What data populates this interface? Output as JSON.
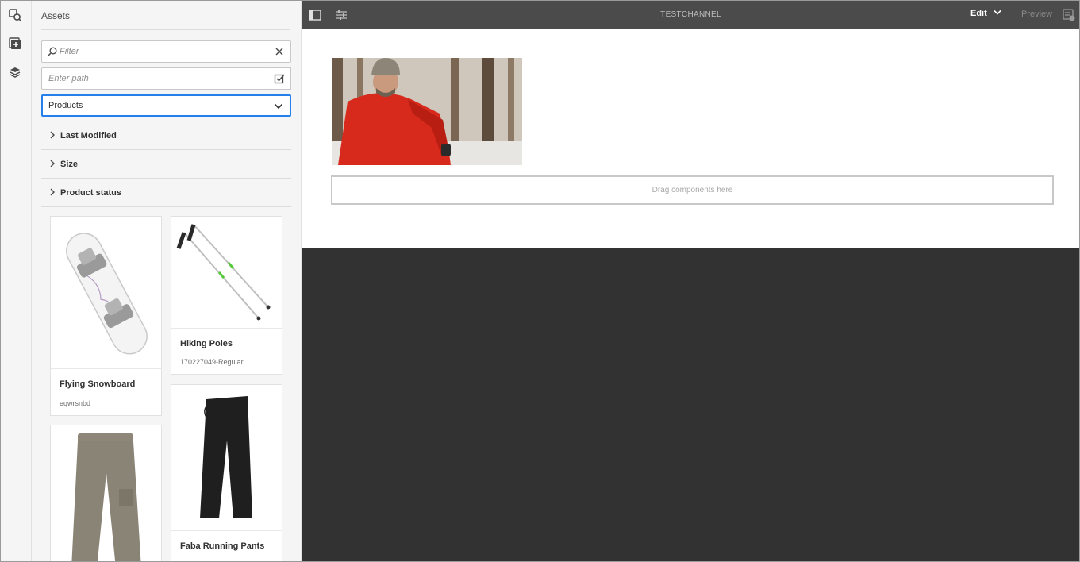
{
  "rail": {
    "items": [
      {
        "icon": "assets-icon"
      },
      {
        "icon": "components-icon"
      },
      {
        "icon": "content-tree-icon"
      }
    ]
  },
  "panel": {
    "title": "Assets",
    "filter_placeholder": "Filter",
    "path_placeholder": "Enter path",
    "asset_type": "Products",
    "facets": [
      "Last Modified",
      "Size",
      "Product status"
    ],
    "cards": [
      {
        "title": "Flying Snowboard",
        "subtitle": "eqwrsnbd"
      },
      {
        "title": "Hiking Poles",
        "subtitle": "170227049-Regular"
      },
      {
        "title": "",
        "subtitle": ""
      },
      {
        "title": "Faba Running Pants",
        "subtitle": ""
      }
    ]
  },
  "topbar": {
    "title": "TESTCHANNEL",
    "mode": "Edit",
    "preview": "Preview"
  },
  "canvas": {
    "dropzone_text": "Drag components here"
  },
  "colors": {
    "accent": "#2680eb",
    "topbar": "#4b4b4b",
    "canvas_bg": "#323232",
    "panel_bg": "#f5f5f5"
  }
}
